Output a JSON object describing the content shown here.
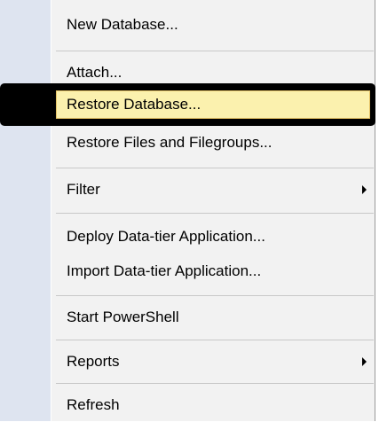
{
  "menu": {
    "items": [
      {
        "label": "New Database..."
      },
      {
        "label": "Attach..."
      },
      {
        "label": "Restore Database..."
      },
      {
        "label": "Restore Files and Filegroups..."
      },
      {
        "label": "Filter"
      },
      {
        "label": "Deploy Data-tier Application..."
      },
      {
        "label": "Import Data-tier Application..."
      },
      {
        "label": "Start PowerShell"
      },
      {
        "label": "Reports"
      },
      {
        "label": "Refresh"
      }
    ],
    "highlighted_item": "Restore Database...",
    "highlight_color": "#fbf1ae",
    "callout_border_color": "#000000"
  }
}
